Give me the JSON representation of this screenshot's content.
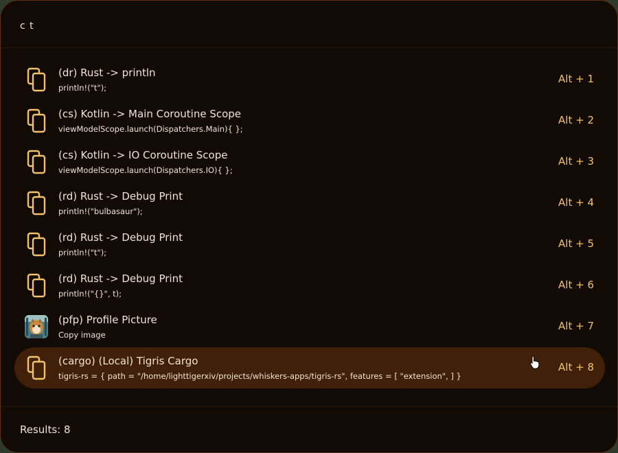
{
  "search": {
    "value": "c t",
    "placeholder": ""
  },
  "results": [
    {
      "icon": "copy-icon",
      "title": "(dr) Rust -> println",
      "subtitle": "println!(\"t\");",
      "shortcut": "Alt + 1"
    },
    {
      "icon": "copy-icon",
      "title": "(cs) Kotlin -> Main Coroutine Scope",
      "subtitle": "viewModelScope.launch(Dispatchers.Main){ };",
      "shortcut": "Alt + 2"
    },
    {
      "icon": "copy-icon",
      "title": "(cs) Kotlin -> IO Coroutine Scope",
      "subtitle": "viewModelScope.launch(Dispatchers.IO){ };",
      "shortcut": "Alt + 3"
    },
    {
      "icon": "copy-icon",
      "title": "(rd) Rust -> Debug Print",
      "subtitle": "println!(\"bulbasaur\");",
      "shortcut": "Alt + 4"
    },
    {
      "icon": "copy-icon",
      "title": "(rd) Rust -> Debug Print",
      "subtitle": "println!(\"t\");",
      "shortcut": "Alt + 5"
    },
    {
      "icon": "copy-icon",
      "title": "(rd) Rust -> Debug Print",
      "subtitle": "println!(\"{}\", t);",
      "shortcut": "Alt + 6"
    },
    {
      "icon": "profile-picture-icon",
      "title": "(pfp) Profile Picture",
      "subtitle": "Copy image",
      "shortcut": "Alt + 7"
    },
    {
      "icon": "copy-icon",
      "title": "(cargo) (Local) Tigris Cargo",
      "subtitle": "tigris-rs = { path = \"/home/lighttigerxiv/projects/whiskers-apps/tigris-rs\", features = [ \"extension\", ] }",
      "shortcut": "Alt + 8",
      "selected": true
    }
  ],
  "footer": {
    "results_label": "Results: 8"
  },
  "colors": {
    "accent": "#f3c26c",
    "background": "#120a05",
    "selected_row": "#402008",
    "text": "#f1e3d4"
  }
}
